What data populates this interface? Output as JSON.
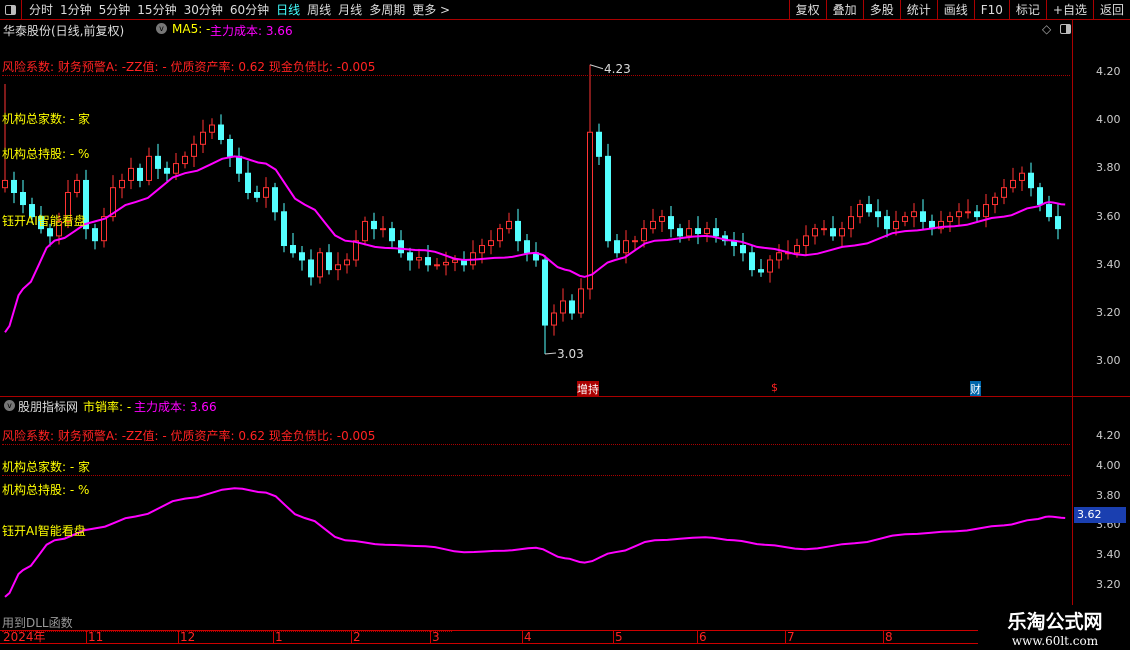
{
  "toolbar": {
    "periods": [
      "分时",
      "1分钟",
      "5分钟",
      "15分钟",
      "30分钟",
      "60分钟",
      "日线",
      "周线",
      "月线",
      "多周期",
      "更多 >"
    ],
    "active": "日线",
    "buttons": [
      "复权",
      "叠加",
      "多股",
      "统计",
      "画线",
      "F10",
      "标记",
      "+自选",
      "返回"
    ]
  },
  "main_pane": {
    "title": "华泰股份(日线,前复权)",
    "ma5": "MA5: -",
    "cost_label": "主力成本: 3.66",
    "risk": "风险系数: 财务预警A: -ZZ值: - 优质资产率: 0.62 现金负债比: -0.005",
    "inst_count": "机构总家数:  -  家",
    "inst_hold": "机构总持股:  -  %",
    "ai": "钰开AI智能看盘",
    "high_label": "4.23",
    "low_label": "3.03",
    "markers": [
      "增持",
      "$",
      "财"
    ]
  },
  "sub_pane": {
    "title": "股朋指标网",
    "ps": "市销率: -",
    "cost_label": "主力成本: 3.66",
    "risk": "风险系数: 财务预警A: -ZZ值: - 优质资产率: 0.62 现金负债比: -0.005",
    "inst_count": "机构总家数:  -  家",
    "inst_hold": "机构总持股:  -  %",
    "ai": "钰开AI智能看盘",
    "current": "3.62",
    "dll": "用到DLL函数"
  },
  "axis_main": [
    "4.20",
    "4.00",
    "3.80",
    "3.60",
    "3.40",
    "3.20",
    "3.00"
  ],
  "axis_sub": [
    "4.20",
    "4.00",
    "3.80",
    "3.60",
    "3.40",
    "3.20"
  ],
  "dates": [
    "2024年",
    "11",
    "12",
    "1",
    "2",
    "3",
    "4",
    "5",
    "6",
    "7",
    "8"
  ],
  "watermark": {
    "name": "乐淘公式网",
    "url": "www.60lt.com"
  },
  "colors": {
    "up": "#ff3333",
    "down": "#54ffff",
    "ma": "#ff00ff"
  },
  "chart_data": {
    "type": "candlestick",
    "closes": [
      3.75,
      3.7,
      3.65,
      3.6,
      3.55,
      3.52,
      3.58,
      3.7,
      3.75,
      3.55,
      3.5,
      3.6,
      3.72,
      3.75,
      3.8,
      3.75,
      3.85,
      3.8,
      3.78,
      3.82,
      3.85,
      3.9,
      3.95,
      3.98,
      3.92,
      3.85,
      3.78,
      3.7,
      3.68,
      3.72,
      3.62,
      3.48,
      3.45,
      3.42,
      3.35,
      3.45,
      3.38,
      3.4,
      3.42,
      3.5,
      3.58,
      3.55,
      3.55,
      3.5,
      3.45,
      3.42,
      3.43,
      3.4,
      3.4,
      3.41,
      3.42,
      3.4,
      3.45,
      3.48,
      3.5,
      3.55,
      3.58,
      3.5,
      3.45,
      3.42,
      3.15,
      3.2,
      3.25,
      3.2,
      3.3,
      3.95,
      3.85,
      3.5,
      3.45,
      3.5,
      3.5,
      3.55,
      3.58,
      3.6,
      3.55,
      3.52,
      3.55,
      3.53,
      3.55,
      3.52,
      3.5,
      3.48,
      3.45,
      3.38,
      3.37,
      3.42,
      3.45,
      3.45,
      3.48,
      3.52,
      3.55,
      3.55,
      3.52,
      3.55,
      3.6,
      3.65,
      3.62,
      3.6,
      3.55,
      3.58,
      3.6,
      3.62,
      3.58,
      3.55,
      3.58,
      3.6,
      3.62,
      3.62,
      3.6,
      3.65,
      3.68,
      3.72,
      3.75,
      3.78,
      3.72,
      3.65,
      3.6,
      3.55
    ],
    "ma_points": [
      [
        0,
        3.12
      ],
      [
        2,
        3.3
      ],
      [
        5.5,
        3.5
      ],
      [
        10,
        3.58
      ],
      [
        14.5,
        3.66
      ],
      [
        20,
        3.78
      ],
      [
        25.5,
        3.85
      ],
      [
        29,
        3.82
      ],
      [
        33.3,
        3.65
      ],
      [
        37.8,
        3.5
      ],
      [
        42.2,
        3.47
      ],
      [
        46.7,
        3.46
      ],
      [
        51,
        3.42
      ],
      [
        55.5,
        3.43
      ],
      [
        59,
        3.45
      ],
      [
        62.2,
        3.38
      ],
      [
        64.4,
        3.35
      ],
      [
        67.8,
        3.42
      ],
      [
        72.2,
        3.5
      ],
      [
        77.8,
        3.52
      ],
      [
        81,
        3.5
      ],
      [
        84.4,
        3.47
      ],
      [
        88.9,
        3.44
      ],
      [
        94.4,
        3.48
      ],
      [
        100,
        3.54
      ],
      [
        105.5,
        3.56
      ],
      [
        111,
        3.6
      ],
      [
        114.4,
        3.64
      ],
      [
        116,
        3.66
      ],
      [
        117.8,
        3.65
      ]
    ],
    "high": 4.23,
    "low": 3.03
  }
}
